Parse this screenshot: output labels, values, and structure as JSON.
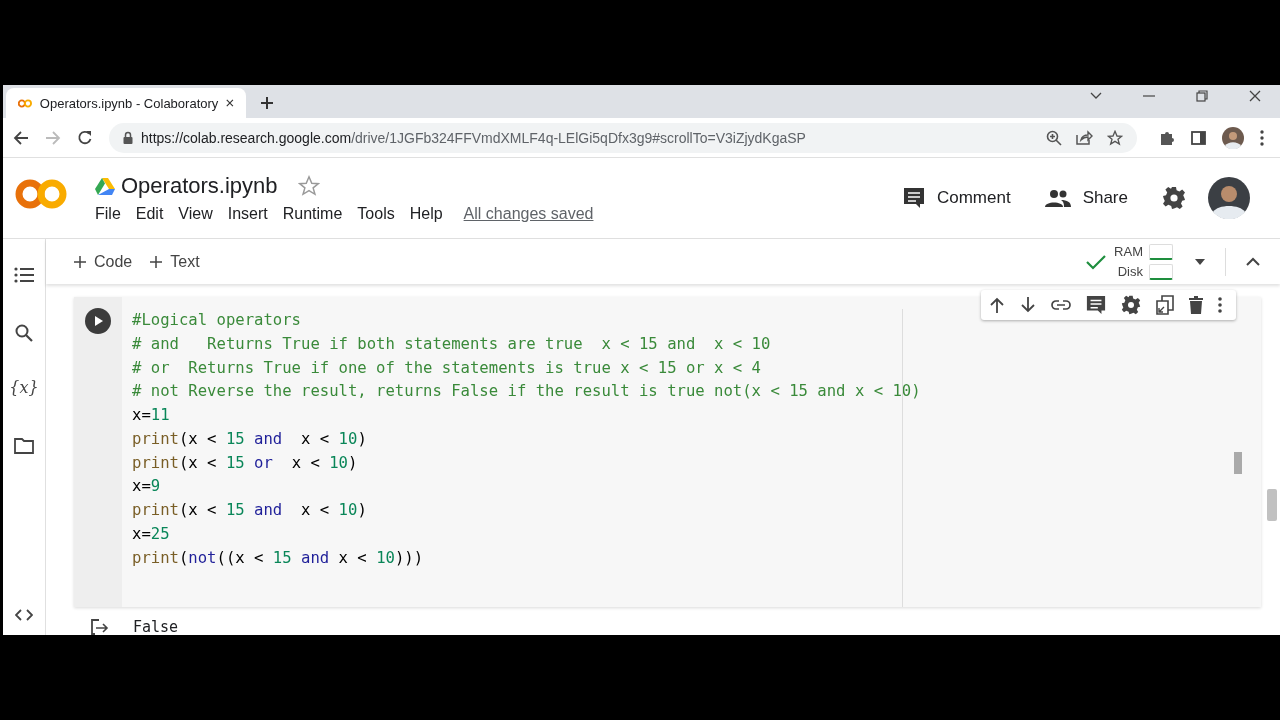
{
  "browser": {
    "tabs": [
      {
        "title": "Operators.ipynb - Colaboratory",
        "selected": true
      }
    ],
    "url": {
      "host": "https://colab.research.google.com",
      "path": "/drive/1JGFb324FFVmdXMLF4q-LElGi5qDfx3g9#scrollTo=V3iZjydKgaSP"
    }
  },
  "header": {
    "title": "Operators.ipynb",
    "starred": false,
    "menu": [
      "File",
      "Edit",
      "View",
      "Insert",
      "Runtime",
      "Tools",
      "Help"
    ],
    "save_status": "All changes saved",
    "comment": "Comment",
    "share": "Share"
  },
  "sidebar": {
    "variables": "{x}"
  },
  "toolbar": {
    "add_buttons": [
      "Code",
      "Text"
    ],
    "connected": true,
    "resources": [
      {
        "label": "RAM"
      },
      {
        "label": "Disk"
      }
    ]
  },
  "cell": {
    "lines": [
      [
        {
          "kind": "comment",
          "text": "#Logical operators"
        }
      ],
      [
        {
          "kind": "comment",
          "text": "# and   Returns True if both statements are true  x < 15 and  x < 10"
        }
      ],
      [
        {
          "kind": "comment",
          "text": "# or  Returns True if one of the statements is true x < 15 or x < 4"
        }
      ],
      [
        {
          "kind": "comment",
          "text": "# not Reverse the result, returns False if the result is true not(x < 15 and x < 10)"
        }
      ],
      [
        {
          "kind": "plain",
          "text": "x="
        },
        {
          "kind": "number",
          "text": "11"
        }
      ],
      [
        {
          "kind": "builtin",
          "text": "print"
        },
        {
          "kind": "plain",
          "text": "(x < "
        },
        {
          "kind": "number",
          "text": "15"
        },
        {
          "kind": "keyword",
          "text": " and"
        },
        {
          "kind": "plain",
          "text": "  x < "
        },
        {
          "kind": "number",
          "text": "10"
        },
        {
          "kind": "plain",
          "text": ")"
        }
      ],
      [
        {
          "kind": "builtin",
          "text": "print"
        },
        {
          "kind": "plain",
          "text": "(x < "
        },
        {
          "kind": "number",
          "text": "15"
        },
        {
          "kind": "keyword",
          "text": " or"
        },
        {
          "kind": "plain",
          "text": "  x < "
        },
        {
          "kind": "number",
          "text": "10"
        },
        {
          "kind": "plain",
          "text": ")"
        }
      ],
      [
        {
          "kind": "plain",
          "text": "x="
        },
        {
          "kind": "number",
          "text": "9"
        }
      ],
      [
        {
          "kind": "builtin",
          "text": "print"
        },
        {
          "kind": "plain",
          "text": "(x < "
        },
        {
          "kind": "number",
          "text": "15"
        },
        {
          "kind": "keyword",
          "text": " and"
        },
        {
          "kind": "plain",
          "text": "  x < "
        },
        {
          "kind": "number",
          "text": "10"
        },
        {
          "kind": "plain",
          "text": ")"
        }
      ],
      [
        {
          "kind": "plain",
          "text": "x="
        },
        {
          "kind": "number",
          "text": "25"
        }
      ],
      [
        {
          "kind": "builtin",
          "text": "print"
        },
        {
          "kind": "plain",
          "text": "("
        },
        {
          "kind": "keyword",
          "text": "not"
        },
        {
          "kind": "plain",
          "text": "((x < "
        },
        {
          "kind": "number",
          "text": "15"
        },
        {
          "kind": "keyword",
          "text": " and"
        },
        {
          "kind": "plain",
          "text": " x < "
        },
        {
          "kind": "number",
          "text": "10"
        },
        {
          "kind": "plain",
          "text": ")))"
        }
      ]
    ],
    "output": "False"
  }
}
